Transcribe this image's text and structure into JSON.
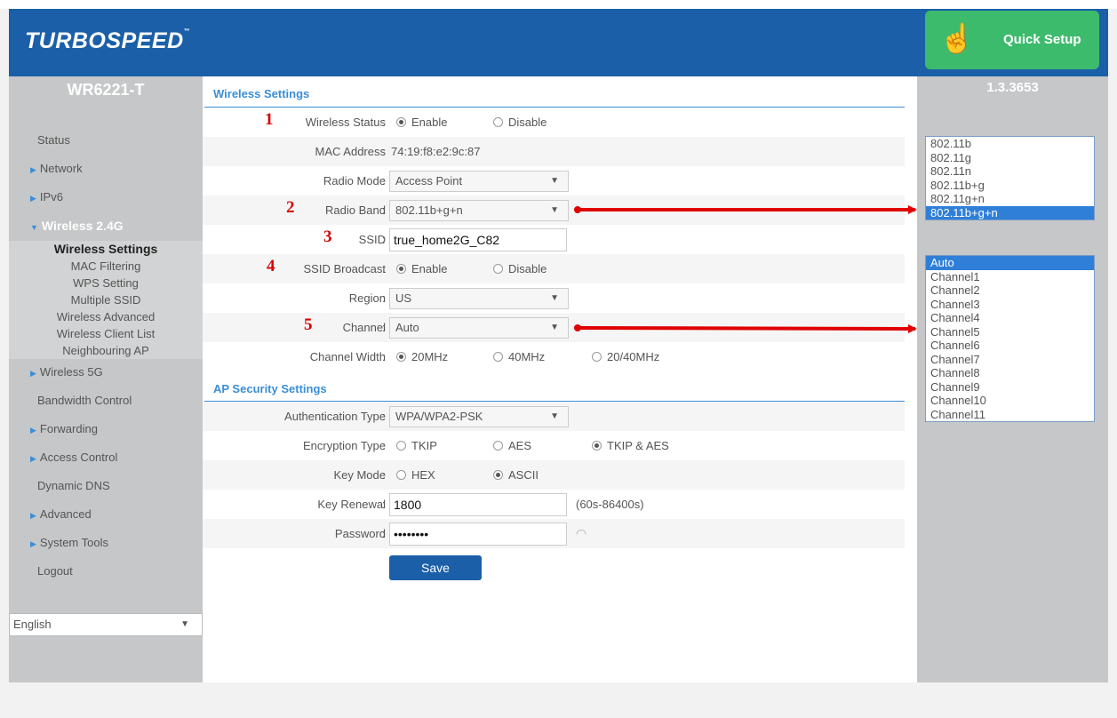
{
  "header": {
    "brand": "TURBOSPEED",
    "quick_setup": "Quick Setup"
  },
  "sidebar": {
    "model": "WR6221-T",
    "nav": [
      {
        "label": "Status",
        "arrow": false
      },
      {
        "label": "Network",
        "arrow": true
      },
      {
        "label": "IPv6",
        "arrow": true
      },
      {
        "label": "Wireless 2.4G",
        "arrow": true,
        "open": true
      }
    ],
    "wireless_sub": [
      "Wireless Settings",
      "MAC Filtering",
      "WPS Setting",
      "Multiple SSID",
      "Wireless Advanced",
      "Wireless Client List",
      "Neighbouring AP"
    ],
    "nav_after": [
      {
        "label": "Wireless 5G",
        "arrow": true
      },
      {
        "label": "Bandwidth Control",
        "arrow": false
      },
      {
        "label": "Forwarding",
        "arrow": true
      },
      {
        "label": "Access Control",
        "arrow": true
      },
      {
        "label": "Dynamic DNS",
        "arrow": false
      },
      {
        "label": "Advanced",
        "arrow": true
      },
      {
        "label": "System Tools",
        "arrow": true
      },
      {
        "label": "Logout",
        "arrow": false
      }
    ],
    "language": "English"
  },
  "wireless": {
    "title": "Wireless Settings",
    "status_label": "Wireless Status",
    "enable": "Enable",
    "disable": "Disable",
    "mac_label": "MAC Address",
    "mac_value": "74:19:f8:e2:9c:87",
    "radio_mode_label": "Radio Mode",
    "radio_mode_value": "Access Point",
    "radio_band_label": "Radio Band",
    "radio_band_value": "802.11b+g+n",
    "ssid_label": "SSID",
    "ssid_value": "true_home2G_C82",
    "broadcast_label": "SSID Broadcast",
    "region_label": "Region",
    "region_value": "US",
    "channel_label": "Channel",
    "channel_value": "Auto",
    "width_label": "Channel Width",
    "width_20": "20MHz",
    "width_40": "40MHz",
    "width_2040": "20/40MHz"
  },
  "annotations": {
    "n1": "1",
    "n2": "2",
    "n3": "3",
    "n4": "4",
    "n5": "5"
  },
  "security": {
    "title": "AP Security Settings",
    "auth_label": "Authentication Type",
    "auth_value": "WPA/WPA2-PSK",
    "enc_label": "Encryption Type",
    "enc_tkip": "TKIP",
    "enc_aes": "AES",
    "enc_both": "TKIP & AES",
    "keymode_label": "Key Mode",
    "key_hex": "HEX",
    "key_ascii": "ASCII",
    "renewal_label": "Key Renewal",
    "renewal_value": "1800",
    "renewal_hint": "(60s-86400s)",
    "password_label": "Password",
    "password_value": "••••••••",
    "save": "Save"
  },
  "right": {
    "version": "1.3.3653",
    "band_options": [
      "802.11b",
      "802.11g",
      "802.11n",
      "802.11b+g",
      "802.11g+n",
      "802.11b+g+n"
    ],
    "band_selected": "802.11b+g+n",
    "channel_options": [
      "Auto",
      "Channel1",
      "Channel2",
      "Channel3",
      "Channel4",
      "Channel5",
      "Channel6",
      "Channel7",
      "Channel8",
      "Channel9",
      "Channel10",
      "Channel11"
    ],
    "channel_selected": "Auto"
  },
  "colors": {
    "header_blue": "#1a5fa8",
    "accent_blue": "#3a8ed7",
    "quick_setup_green": "#3dbb6d",
    "annotation_red": "#d40000",
    "sidebar_gray": "#c6c7c8"
  }
}
